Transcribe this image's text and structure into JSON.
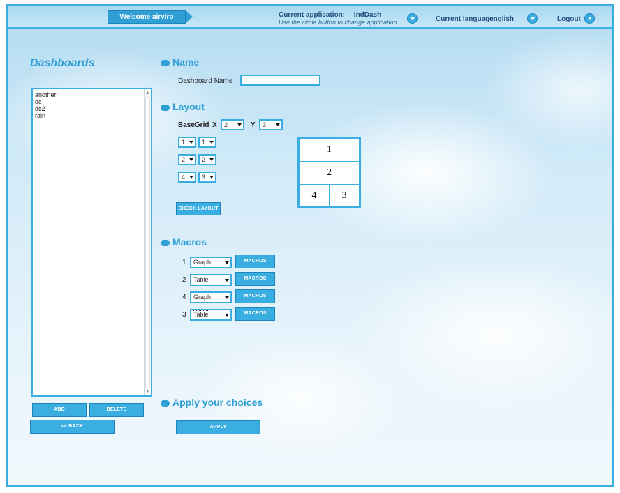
{
  "header": {
    "welcome": "Welcome airviro",
    "current_application_label": "Current application:",
    "current_application_value": "IndDash",
    "change_hint": "Use the circle button to change application",
    "language_label": "Current language:",
    "language_value": "english",
    "logout": "Logout",
    "icons": {
      "change_application": "chevron-down-icon",
      "change_language": "chevron-down-icon",
      "logout": "arrow-right-icon"
    }
  },
  "dashboards": {
    "title": "Dashboards",
    "items": [
      "another",
      "dc",
      "dc2",
      "rain"
    ],
    "add_label": "ADD",
    "delete_label": "DELETE",
    "back_label": "<< BACK"
  },
  "name_section": {
    "title": "Name",
    "field_label": "Dashboard Name",
    "field_value": ""
  },
  "layout_section": {
    "title": "Layout",
    "basegrid_label": "BaseGrid",
    "x_label": "X",
    "x_value": "2",
    "y_label": "Y",
    "y_value": "3",
    "rows": [
      [
        "1",
        "1"
      ],
      [
        "2",
        "2"
      ],
      [
        "4",
        "3"
      ]
    ],
    "check_label": "CHECK LAYOUT",
    "preview": [
      "1",
      "2",
      "4",
      "3"
    ]
  },
  "macros_section": {
    "title": "Macros",
    "rows": [
      {
        "num": "1",
        "type": "Graph",
        "button": "MACROS"
      },
      {
        "num": "2",
        "type": "Table",
        "button": "MACROS"
      },
      {
        "num": "4",
        "type": "Graph",
        "button": "MACROS"
      },
      {
        "num": "3",
        "type": "Table",
        "button": "MACROS"
      }
    ]
  },
  "apply_section": {
    "title": "Apply your choices",
    "apply_label": "APPLY"
  },
  "colors": {
    "accent": "#3aaee0",
    "accent_dark": "#2f9fd6",
    "header_text": "#20507c"
  }
}
